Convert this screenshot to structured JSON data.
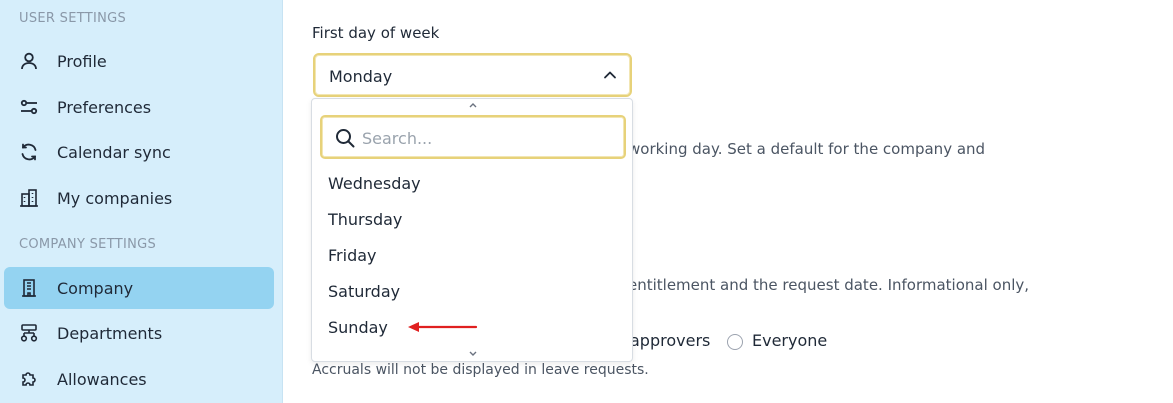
{
  "sidebar": {
    "user_section_label": "USER SETTINGS",
    "company_section_label": "COMPANY SETTINGS",
    "user_items": [
      {
        "label": "Profile",
        "icon": "user-icon"
      },
      {
        "label": "Preferences",
        "icon": "sliders-icon"
      },
      {
        "label": "Calendar sync",
        "icon": "sync-icon"
      },
      {
        "label": "My companies",
        "icon": "buildings-icon"
      }
    ],
    "company_items": [
      {
        "label": "Company",
        "icon": "building-icon",
        "active": true
      },
      {
        "label": "Departments",
        "icon": "hierarchy-icon"
      },
      {
        "label": "Allowances",
        "icon": "puzzle-icon"
      }
    ]
  },
  "main": {
    "first_day_label": "First day of week",
    "first_day_value": "Monday",
    "working_day_text": "working day. Set a default for the company and",
    "entitlement_text": "entitlement and the request date. Informational only,",
    "radio_partial_label": "approvers",
    "radio_everyone_label": "Everyone",
    "accruals_note": "Accruals will not be displayed in leave requests."
  },
  "dropdown": {
    "search_placeholder": "Search...",
    "search_value": "",
    "options": [
      "Wednesday",
      "Thursday",
      "Friday",
      "Saturday",
      "Sunday"
    ]
  },
  "colors": {
    "sidebar_bg": "#d6eefb",
    "active_item_bg": "#94d3f1",
    "focus_border": "#e7d27a",
    "annotation_arrow": "#e02020"
  }
}
